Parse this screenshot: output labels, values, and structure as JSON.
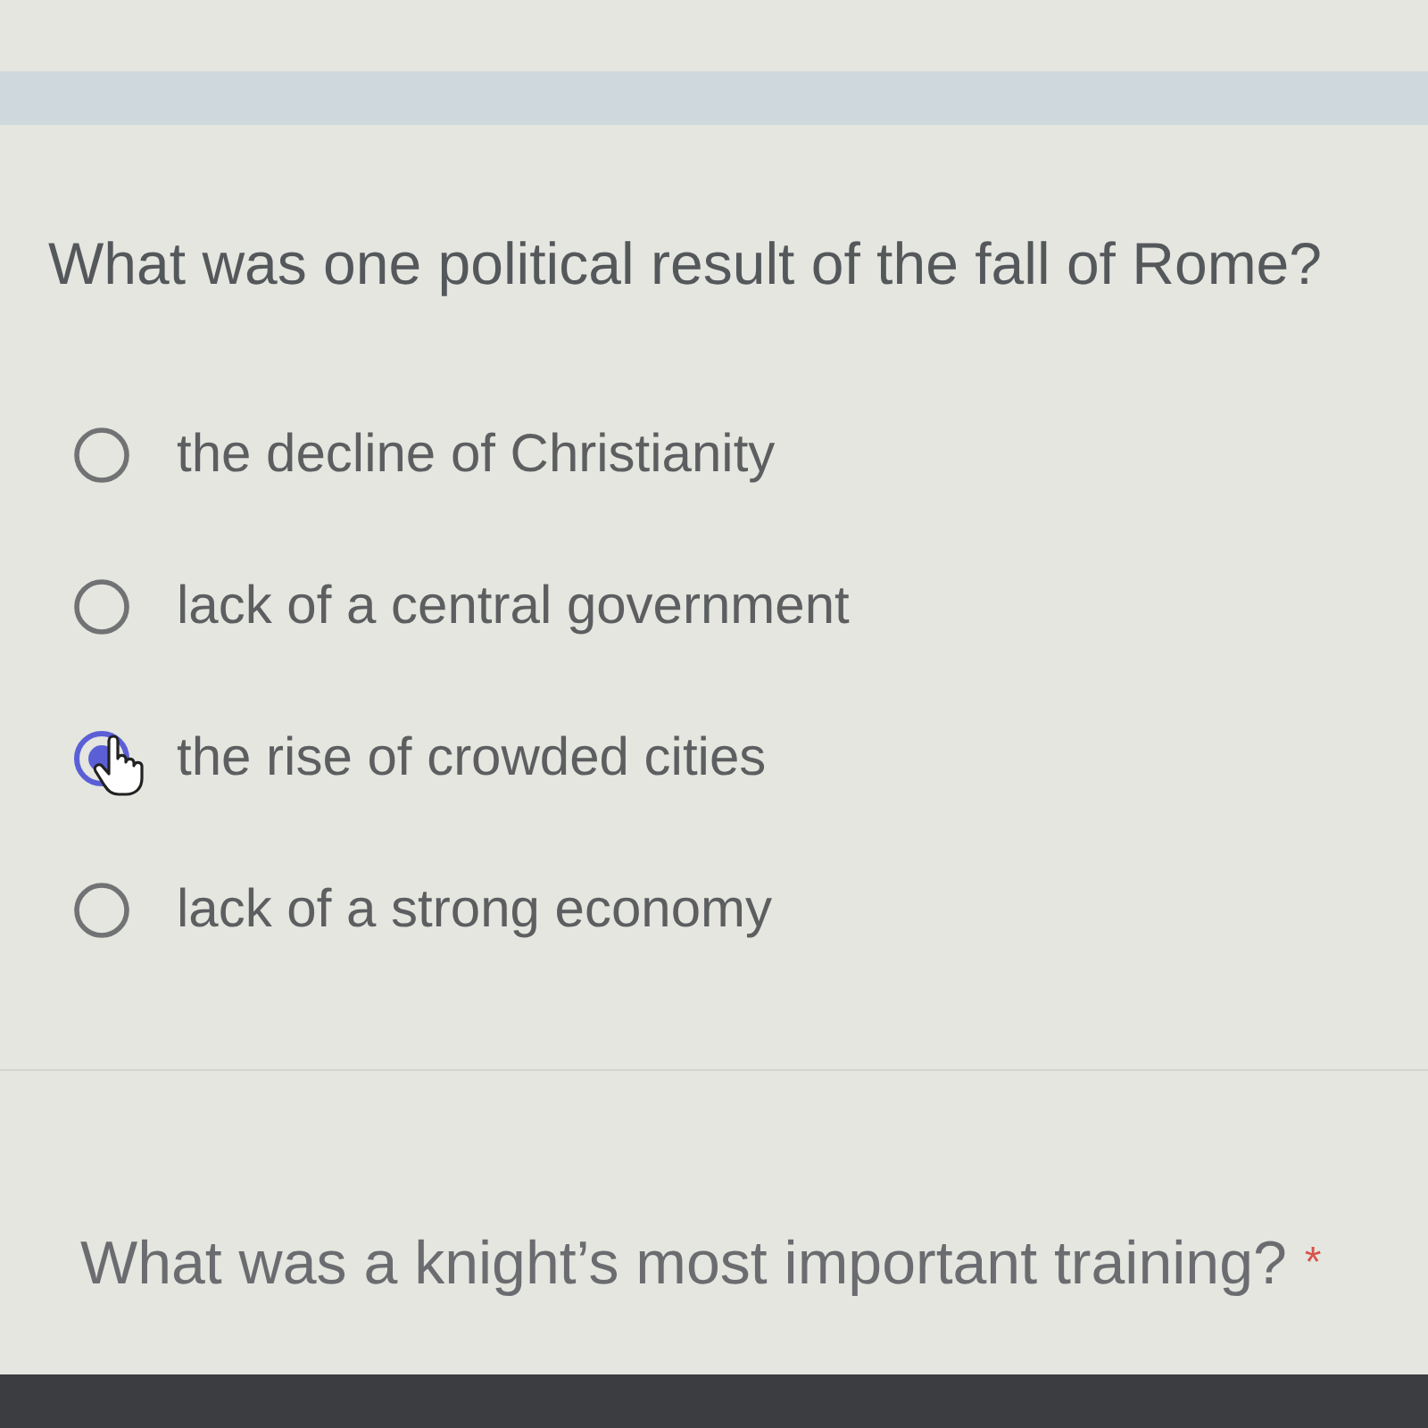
{
  "questions": [
    {
      "text": "What was one political result of the fall of Rome?",
      "options": [
        {
          "label": "the decline of Christianity",
          "selected": false
        },
        {
          "label": "lack of a central government",
          "selected": false
        },
        {
          "label": "the rise of crowded cities",
          "selected": true
        },
        {
          "label": "lack of a strong economy",
          "selected": false
        }
      ]
    },
    {
      "text": "What was a knight’s most important training?",
      "required_mark": "*"
    }
  ]
}
